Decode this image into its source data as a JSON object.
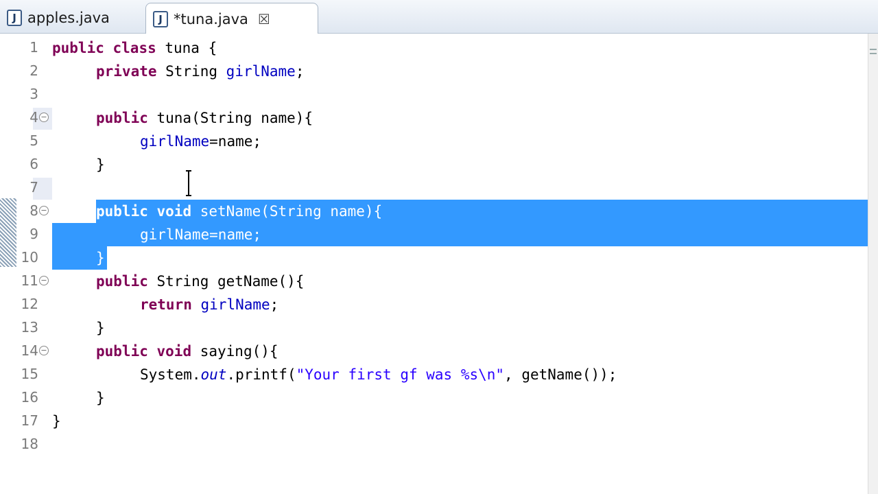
{
  "tabs": [
    {
      "label": "apples.java",
      "icon": "java-file-icon",
      "active": false
    },
    {
      "label": "*tuna.java",
      "icon": "java-file-icon",
      "active": true
    }
  ],
  "icons": {
    "file": "java-file-icon",
    "close": "close-icon",
    "fold": "fold-collapse-icon"
  },
  "colors": {
    "keyword": "#7f0055",
    "string": "#2a00ff",
    "field": "#0000c0",
    "selection": "#3399ff"
  },
  "editor": {
    "line_numbers": [
      "1",
      "2",
      "3",
      "4",
      "5",
      "6",
      "7",
      "8",
      "9",
      "10",
      "11",
      "12",
      "13",
      "14",
      "15",
      "16",
      "17",
      "18"
    ],
    "lines": {
      "l1": {
        "kw1": "public",
        "kw2": "class",
        "rest": " tuna {"
      },
      "l2": {
        "kw1": "private",
        "type": " String ",
        "fld": "girlName",
        "end": ";"
      },
      "l4": {
        "kw1": "public",
        "rest": " tuna(String name){"
      },
      "l5": {
        "fld": "girlName",
        "rest": "=name;"
      },
      "l6": {
        "text": "}"
      },
      "l8": {
        "kw1": "public",
        "kw2": "void",
        "rest": " setName(String name){"
      },
      "l9": {
        "fld": "girlName",
        "rest": "=name;"
      },
      "l10": {
        "text": "}"
      },
      "l11": {
        "kw1": "public",
        "rest": " String getName(){"
      },
      "l12": {
        "kw1": "return",
        "fld": "girlName",
        "end": ";"
      },
      "l13": {
        "text": "}"
      },
      "l14": {
        "kw1": "public",
        "kw2": "void",
        "rest": " saying(){"
      },
      "l15": {
        "pre": "System.",
        "sfld": "out",
        "mid": ".printf(",
        "str": "\"Your first gf was %s\\n\"",
        "end": ", getName());"
      },
      "l16": {
        "text": "}"
      },
      "l17": {
        "text": "}"
      }
    }
  }
}
